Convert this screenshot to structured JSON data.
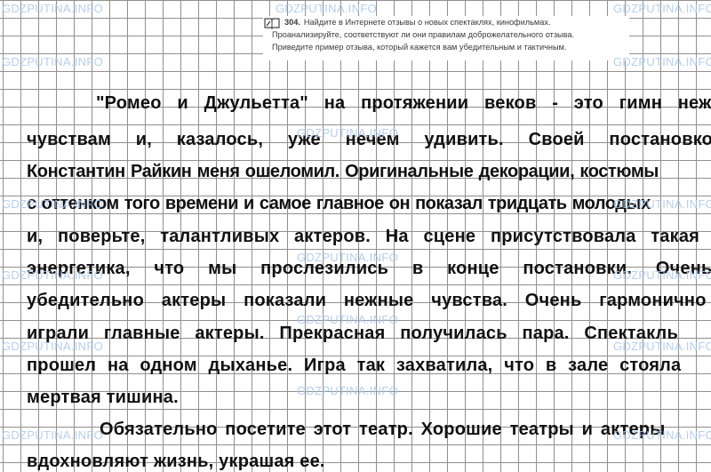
{
  "task": {
    "number": "304.",
    "line1": "Найдите в Интернете отзывы о новых спектаклях, кинофильмах.",
    "line2": "Проанализируйте, соответствуют ли они правилам доброжелательного отзыва.",
    "line3": "Приведите пример отзыва, который кажется вам убедительным и тактичным.",
    "icon": "pencil-book-icon"
  },
  "review": {
    "lines": [
      "\"Ромео и Джульетта\" на протяжении веков - это гимн нежным",
      "чувствам и, казалось, уже нечем удивить. Своей постановкой",
      "Константин Райкин меня ошеломил. Оригинальные декорации, костюмы",
      "с оттенком того времени и самое главное он показал тридцать молодых",
      "и, поверьте, талантливых актеров. На сцене присутствовала такая",
      "энергетика, что мы прослезились в конце постановки. Очень",
      "убедительно актеры показали нежные чувства. Очень гармонично",
      "играли главные актеры. Прекрасная получилась пара. Спектакль",
      "прошел на одном дыханье. Игра так захватила, что в зале стояла",
      "мертвая тишина.",
      "Обязательно посетите этот театр. Хорошие театры и актеры",
      "вдохновляют жизнь, украшая ее."
    ]
  },
  "watermark": {
    "text": "GDZPUTINA.INFO",
    "color": "#a9c7ea"
  }
}
